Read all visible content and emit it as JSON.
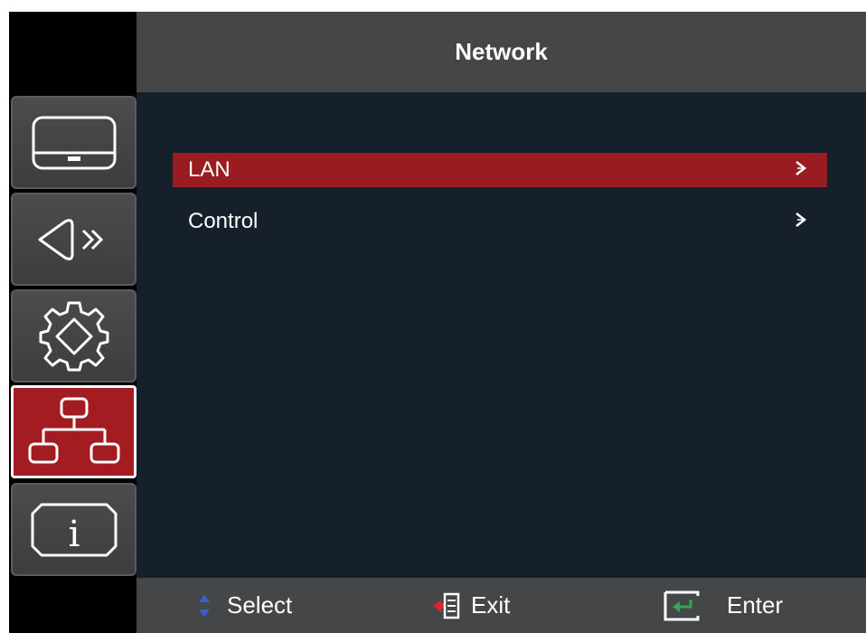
{
  "header": {
    "title": "Network"
  },
  "sidebar": {
    "items": [
      {
        "name": "display",
        "icon": "monitor-icon",
        "active": false
      },
      {
        "name": "audio",
        "icon": "speaker-icon",
        "active": false
      },
      {
        "name": "setup",
        "icon": "gear-icon",
        "active": false
      },
      {
        "name": "network",
        "icon": "network-icon",
        "active": true
      },
      {
        "name": "info",
        "icon": "info-icon",
        "active": false
      }
    ]
  },
  "menu": {
    "items": [
      {
        "label": "LAN",
        "selected": true,
        "icon": "chevron-right-icon"
      },
      {
        "label": "Control",
        "selected": false,
        "icon": "chevron-right-icon"
      }
    ]
  },
  "footer": {
    "select_label": "Select",
    "exit_label": "Exit",
    "enter_label": "Enter"
  },
  "colors": {
    "accent_red": "#a21c22",
    "header_gray": "#444648",
    "content_bg": "#15202b",
    "select_blue": "#3a5fcf",
    "enter_green": "#2fa84f"
  }
}
